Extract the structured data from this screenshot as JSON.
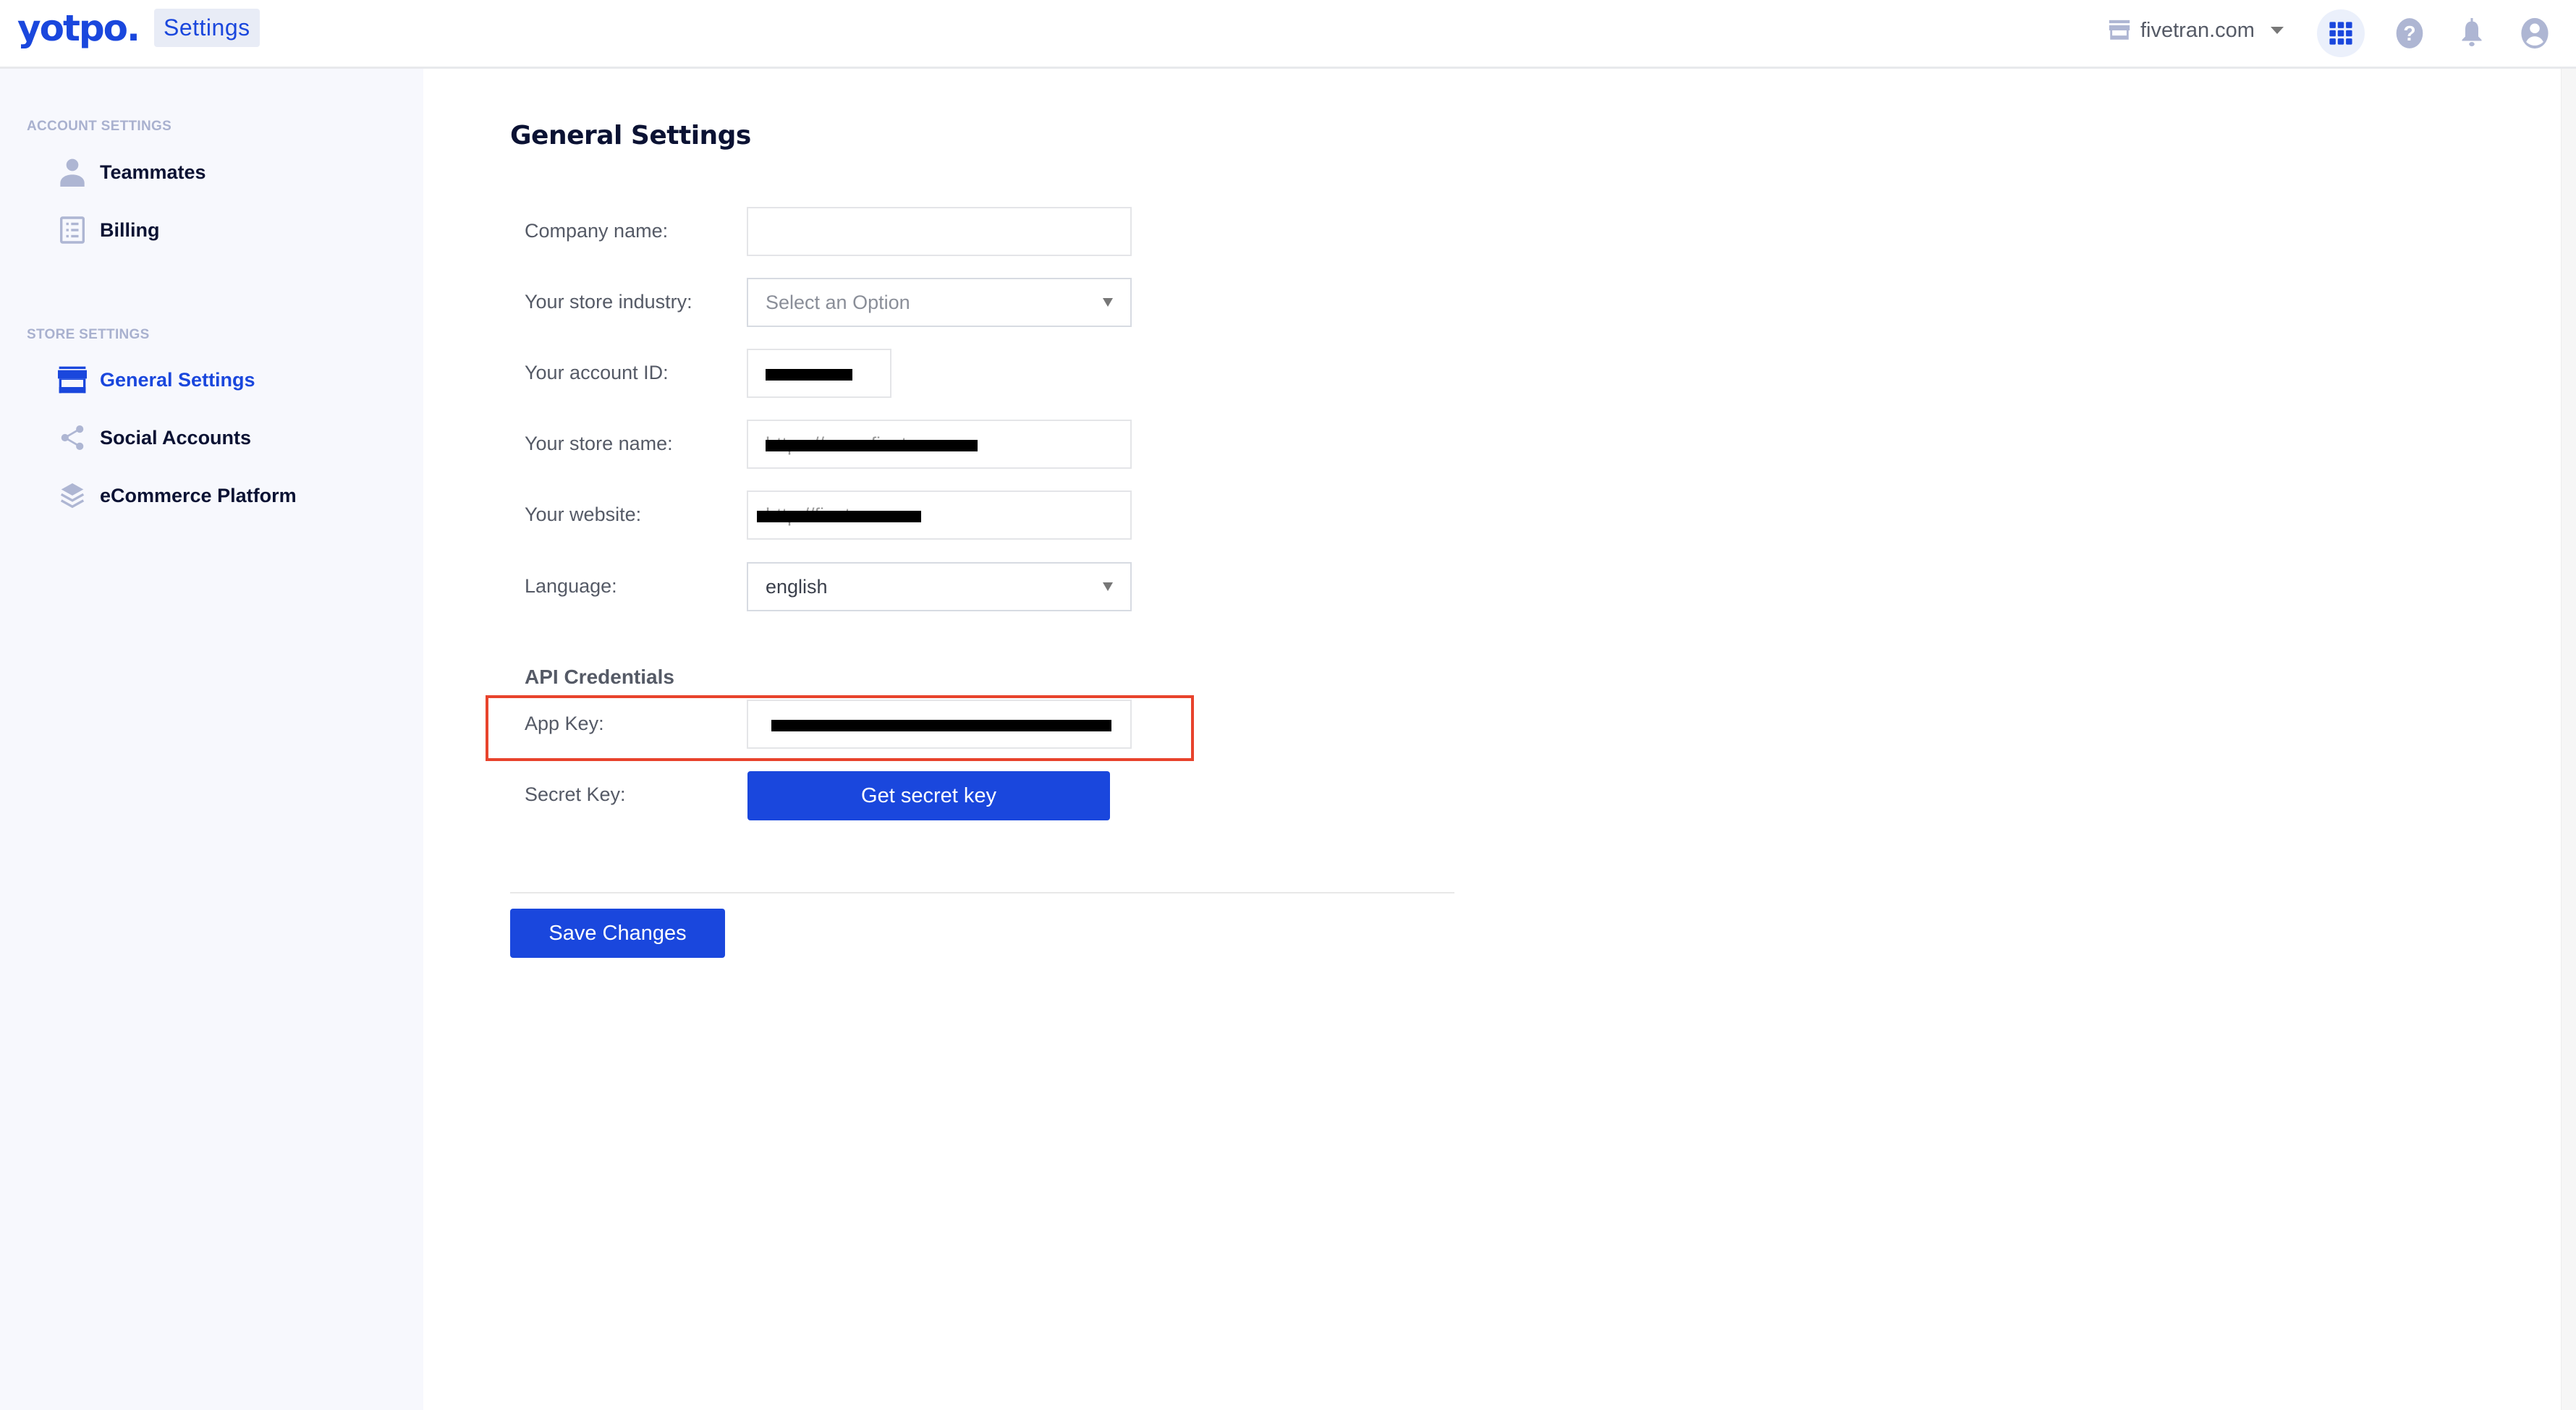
{
  "header": {
    "logo": "yotpo.",
    "app_name": "Settings",
    "store_name": "fivetran.com",
    "icons": {
      "store": "storefront-icon",
      "apps": "apps-grid-icon",
      "help": "help-circle-icon",
      "notifications": "bell-icon",
      "account": "user-circle-icon"
    }
  },
  "sidebar": {
    "sections": [
      {
        "title": "ACCOUNT SETTINGS",
        "items": [
          {
            "label": "Teammates",
            "icon": "person-icon",
            "active": false
          },
          {
            "label": "Billing",
            "icon": "list-document-icon",
            "active": false
          }
        ]
      },
      {
        "title": "STORE SETTINGS",
        "items": [
          {
            "label": "General Settings",
            "icon": "storefront-icon",
            "active": true
          },
          {
            "label": "Social Accounts",
            "icon": "share-icon",
            "active": false
          },
          {
            "label": "eCommerce Platform",
            "icon": "layers-icon",
            "active": false
          }
        ]
      }
    ]
  },
  "main": {
    "title": "General Settings",
    "fields": {
      "company_name": {
        "label": "Company name:",
        "value": ""
      },
      "store_industry": {
        "label": "Your store industry:",
        "value": "Select an Option",
        "is_placeholder": true
      },
      "account_id": {
        "label": "Your account ID:",
        "value": "[redacted]",
        "redacted": true
      },
      "store_name": {
        "label": "Your store name:",
        "value": "https://www.fivetran.com",
        "redacted": true
      },
      "website": {
        "label": "Your website:",
        "value": "http://fivetran.com",
        "redacted": true
      },
      "language": {
        "label": "Language:",
        "value": "english"
      }
    },
    "api_credentials": {
      "title": "API Credentials",
      "app_key": {
        "label": "App Key:",
        "value": "[redacted]",
        "redacted": true
      },
      "secret_key": {
        "label": "Secret Key:",
        "button_label": "Get secret key"
      }
    },
    "save_button_label": "Save Changes"
  },
  "colors": {
    "brand_blue": "#1a47dd",
    "highlight_red": "#e8432c",
    "sidebar_bg": "#f7f8fd",
    "icon_muted": "#aeb6d3"
  }
}
